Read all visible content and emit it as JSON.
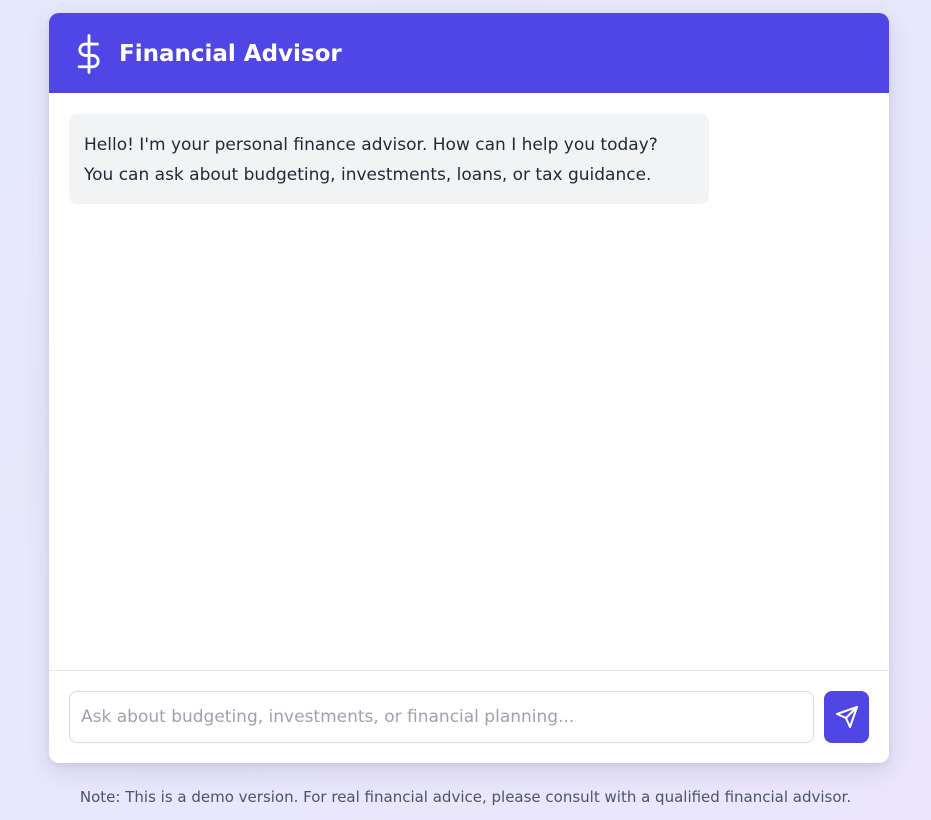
{
  "header": {
    "icon": "dollar-sign-icon",
    "title": "Financial Advisor"
  },
  "messages": [
    {
      "role": "assistant",
      "lines": [
        "Hello! I'm your personal finance advisor. How can I help you today?",
        "You can ask about budgeting, investments, loans, or tax guidance."
      ]
    }
  ],
  "composer": {
    "value": "",
    "placeholder": "Ask about budgeting, investments, or financial planning...",
    "send_icon": "send-icon"
  },
  "footer": {
    "note": "Note: This is a demo version. For real financial advice, please consult with a qualified financial advisor."
  },
  "colors": {
    "accent": "#4f46e5",
    "assistant_bubble": "#f1f3f5",
    "page_background": "#e8e7fb"
  }
}
